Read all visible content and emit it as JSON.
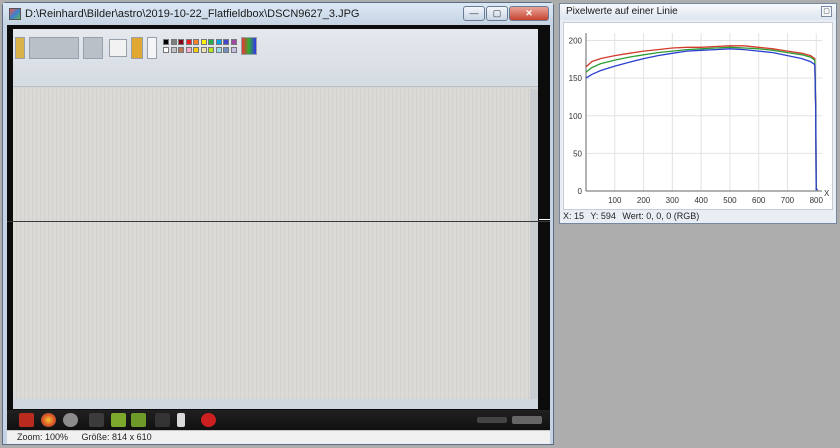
{
  "main_window": {
    "title": "D:\\Reinhard\\Bilder\\astro\\2019-10-22_Flatfieldbox\\DSCN9627_3.JPG",
    "buttons": {
      "minimize": "—",
      "maximize": "▢",
      "close": "✕"
    },
    "status": {
      "zoom": "Zoom: 100%",
      "size": "Größe: 814 x 610"
    }
  },
  "profile_window": {
    "title": "Pixelwerte auf einer Linie",
    "restore_icon": "restore-icon",
    "status": {
      "x": "X: 15",
      "y": "Y: 594",
      "value": "Wert: 0, 0, 0 (RGB)"
    }
  },
  "chart_data": {
    "type": "line",
    "title": "",
    "xlabel": "X",
    "ylabel": "",
    "xlim": [
      0,
      820
    ],
    "ylim": [
      0,
      210
    ],
    "x_ticks": [
      100,
      200,
      300,
      400,
      500,
      600,
      700,
      800
    ],
    "y_ticks": [
      0,
      50,
      100,
      150,
      200
    ],
    "grid": true,
    "series": [
      {
        "color": "#d23a2a",
        "x": [
          0,
          20,
          50,
          100,
          150,
          200,
          250,
          300,
          350,
          400,
          450,
          500,
          550,
          600,
          650,
          700,
          750,
          780,
          795,
          798,
          800,
          805
        ],
        "y": [
          165,
          172,
          176,
          180,
          183,
          186,
          188,
          190,
          191,
          191,
          192,
          193,
          193,
          191,
          189,
          186,
          183,
          180,
          176,
          110,
          2,
          2
        ]
      },
      {
        "color": "#2e9c35",
        "x": [
          0,
          20,
          50,
          100,
          150,
          200,
          250,
          300,
          350,
          400,
          450,
          500,
          550,
          600,
          650,
          700,
          750,
          780,
          795,
          798,
          800,
          805
        ],
        "y": [
          158,
          164,
          169,
          174,
          178,
          181,
          184,
          186,
          188,
          189,
          190,
          191,
          190,
          189,
          187,
          184,
          181,
          178,
          174,
          112,
          2,
          2
        ]
      },
      {
        "color": "#2a3fd0",
        "x": [
          0,
          20,
          50,
          100,
          150,
          200,
          250,
          300,
          350,
          400,
          450,
          500,
          550,
          600,
          650,
          700,
          750,
          780,
          795,
          798,
          800,
          805
        ],
        "y": [
          150,
          155,
          160,
          166,
          171,
          176,
          180,
          183,
          186,
          187,
          188,
          189,
          188,
          186,
          184,
          180,
          176,
          172,
          168,
          108,
          2,
          2
        ]
      }
    ]
  }
}
